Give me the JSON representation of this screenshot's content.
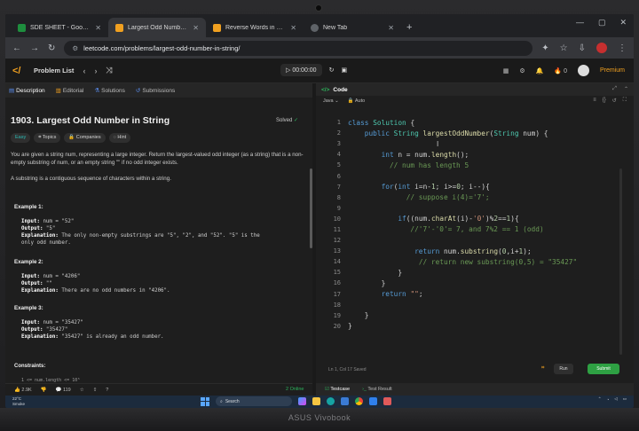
{
  "device": {
    "brand": "ASUS Vivobook"
  },
  "browser": {
    "tabs": [
      {
        "label": "SDE SHEET - Google Sheets",
        "color": "#1e8e3e"
      },
      {
        "label": "Largest Odd Number in String",
        "color": "#f0a020"
      },
      {
        "label": "Reverse Words in a String - Lee",
        "color": "#f0a020"
      },
      {
        "label": "New Tab",
        "color": "#9aa0a6"
      }
    ],
    "url": "leetcode.com/problems/largest-odd-number-in-string/"
  },
  "lc_nav": {
    "problem_list": "Problem List",
    "timer": "00:00:00",
    "streak": "0",
    "premium": "Premium"
  },
  "left_tabs": [
    "Description",
    "Editorial",
    "Solutions",
    "Submissions"
  ],
  "problem": {
    "title": "1903. Largest Odd Number in String",
    "status": "Solved",
    "chips": [
      "Easy",
      "Topics",
      "Companies",
      "Hint"
    ],
    "desc_1": "You are given a string num, representing a large integer. Return the largest-valued odd integer (as a string) that is a non-empty substring of num, or an empty string \"\" if no odd integer exists.",
    "desc_2": "A substring is a contiguous sequence of characters within a string.",
    "examples": [
      {
        "title": "Example 1:",
        "lines": [
          {
            "k": "Input:",
            "v": " num = \"52\""
          },
          {
            "k": "Output:",
            "v": " \"5\""
          },
          {
            "k": "Explanation:",
            "v": " The only non-empty substrings are \"5\", \"2\", and \"52\". \"5\" is the"
          },
          {
            "k": "",
            "v": "only odd number."
          }
        ]
      },
      {
        "title": "Example 2:",
        "lines": [
          {
            "k": "Input:",
            "v": " num = \"4206\""
          },
          {
            "k": "Output:",
            "v": " \"\""
          },
          {
            "k": "Explanation:",
            "v": " There are no odd numbers in \"4206\"."
          }
        ]
      },
      {
        "title": "Example 3:",
        "lines": [
          {
            "k": "Input:",
            "v": " num = \"35427\""
          },
          {
            "k": "Output:",
            "v": " \"35427\""
          },
          {
            "k": "Explanation:",
            "v": " \"35427\" is already an odd number."
          }
        ]
      }
    ],
    "constraints_title": "Constraints:",
    "constraint_1": "1 <= num.length <= 10⁵",
    "likes": "2.9K",
    "dislikes": "119",
    "online": "2 Online"
  },
  "code_panel": {
    "title": "Code",
    "language": "Java",
    "autosave": "Auto",
    "status": "Ln 1, Col 17    Saved",
    "run": "Run",
    "submit": "Submit",
    "bottom_tabs": [
      "Testcase",
      "Test Result"
    ],
    "lines": [
      "class Solution {",
      "    public String largestOddNumber(String num) {",
      "",
      "        int n = num.length();",
      "          // num has length 5",
      "",
      "        for(int i=n-1; i>=0; i--){",
      "              // suppose i(4)='7';",
      "",
      "            if((num.charAt(i)-'0')%2==1){",
      "               //'7'-'0'= 7, and 7%2 == 1 (odd)",
      "",
      "                return num.substring(0,i+1);",
      "                 // return new substring(0,5) = \"35427\"",
      "            }",
      "        }",
      "        return \"\";",
      "",
      "    }",
      "}"
    ]
  },
  "taskbar": {
    "weather_temp": "22°C",
    "weather_desc": "Smoke",
    "search": "Search"
  }
}
